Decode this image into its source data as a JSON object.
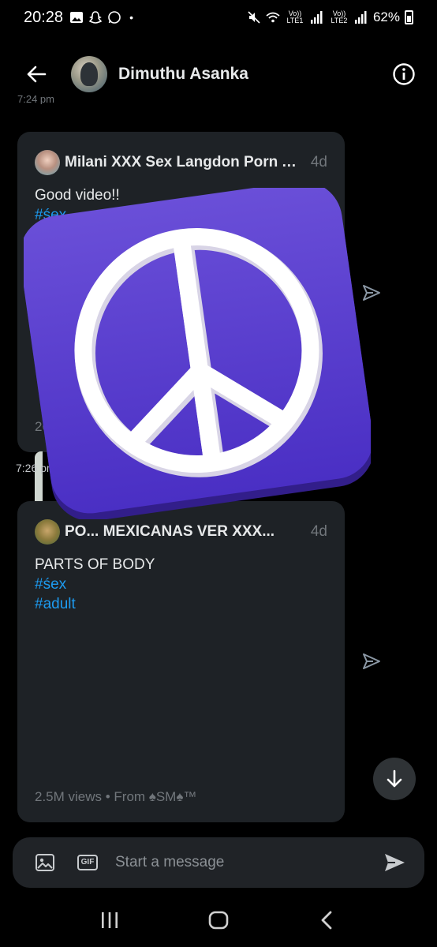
{
  "status_bar": {
    "time": "20:28",
    "dot": "•",
    "net1": "Vo)) LTE1",
    "net2": "Vo)) LTE2",
    "battery": "62%"
  },
  "header": {
    "contact_name": "Dimuthu Asanka"
  },
  "previous_timestamp": "7:24 pm",
  "messages": [
    {
      "author": "Milani XXX Sex Langdon Porn A...",
      "age": "4d",
      "text": "Good video!!",
      "hashtags": [
        "#śex",
        "#a"
      ],
      "footer": "26"
    },
    {
      "author": "PO... MEXICANAS VER XXX...",
      "age": "4d",
      "text": "PARTS OF BODY",
      "hashtags": [
        "#śex",
        "#adult"
      ],
      "footer": "2.5M views • From ♠SM♠™"
    }
  ],
  "message_timestamp": "7:26 pm",
  "composer": {
    "placeholder": "Start a message",
    "gif_label": "GIF"
  },
  "colors": {
    "accent": "#1d9bf0",
    "card_bg": "#1e2226",
    "sticker": "#5b3fd0"
  },
  "icons": {
    "back": "arrow-left-icon",
    "info": "info-icon",
    "share": "send-icon",
    "scroll": "arrow-down-icon",
    "image": "image-icon",
    "send": "send-filled-icon",
    "sticker": "peace-sign-icon"
  }
}
